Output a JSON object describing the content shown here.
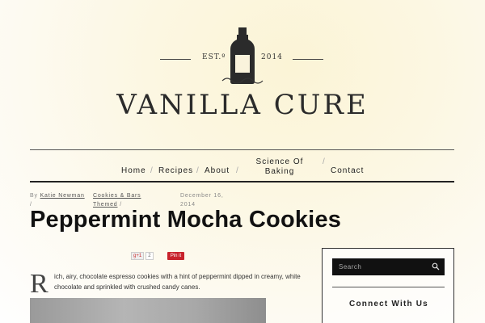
{
  "logo": {
    "est_label": "EST.º",
    "year": "2014",
    "title": "VANILLA CURE"
  },
  "nav": {
    "items": [
      {
        "label": "Home"
      },
      {
        "label": "Recipes"
      },
      {
        "label": "About"
      },
      {
        "label": "Science Of\nBaking"
      },
      {
        "label": "Contact"
      }
    ],
    "separator": "/"
  },
  "post": {
    "by_prefix": "By",
    "author": "Katie Newman",
    "meta_sep": "/",
    "category_line1": "Cookies & Bars",
    "category_line2": "Themed",
    "date_line1": "December 16,",
    "date_line2": "2014",
    "title": "Peppermint Mocha Cookies",
    "gplus_label": "g+1",
    "gplus_count": "2",
    "pin_label": "Pin it",
    "dropcap": "R",
    "intro": "ich, airy, chocolate espresso cookies with a hint of peppermint dipped in creamy, white chocolate and sprinkled with crushed candy canes."
  },
  "sidebar": {
    "search_placeholder": "Search",
    "connect_heading": "Connect With Us"
  },
  "icons": {
    "logo": "bottle-logo-icon",
    "search": "search-icon"
  }
}
